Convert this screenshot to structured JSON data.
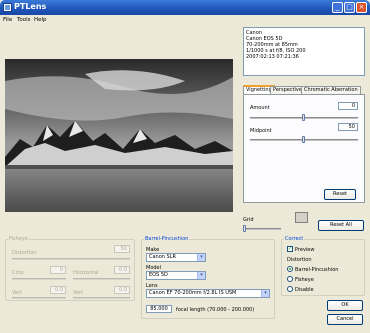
{
  "window": {
    "title": "PTLens"
  },
  "menu": [
    "File",
    "Tools",
    "Help"
  ],
  "info": {
    "lines": [
      "Canon",
      "Canon EOS 5D",
      "70-200mm at 85mm",
      "1/1000 s at f/8, ISO 200",
      "2007:02:13 07:21:36"
    ]
  },
  "tabs": [
    "Vignetting",
    "Perspective",
    "Chromatic Aberration"
  ],
  "vignetting": {
    "amount_label": "Amount",
    "amount_value": "0",
    "amount_level": 0.5,
    "midpoint_label": "Midpoint",
    "midpoint_value": "50",
    "midpoint_level": 0.5,
    "reset_label": "Reset"
  },
  "grid": {
    "label": "Grid",
    "reset_all_label": "Reset All"
  },
  "fisheye": {
    "title": "Fisheye",
    "row1_label": "Distortion",
    "row1_value": "50",
    "row2_left_label": "Crop",
    "row2_left_value": "0",
    "row2_right_label": "Horizontal",
    "row2_right_value": "0.0",
    "row3_left_label": "Vert",
    "row3_left_value": "0.0",
    "row3_right_label": "Vert",
    "row3_right_value": "0.0"
  },
  "barrel": {
    "title": "Barrel-Pincushion",
    "make_label": "Make",
    "make_value": "Canon SLR",
    "model_label": "Model",
    "model_value": "EOS 5D",
    "lens_label": "Lens",
    "lens_value": "Canon EF 70-200mm f/2.8L IS USM",
    "focal_value": "85.000",
    "focal_label": "focal length (70.000 - 200.000)"
  },
  "correct": {
    "title": "Correct",
    "preview_label": "Preview",
    "distortion_label": "Distortion",
    "options": [
      "Barrel-Pincushion",
      "Fisheye",
      "Disable"
    ],
    "selected": "Barrel-Pincushion"
  },
  "buttons": {
    "ok": "OK",
    "cancel": "Cancel"
  }
}
